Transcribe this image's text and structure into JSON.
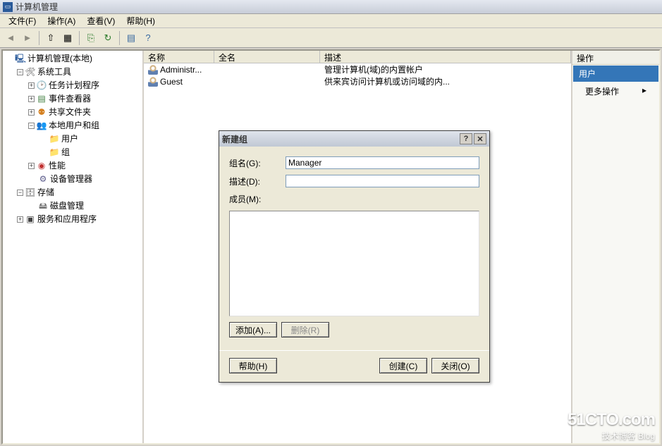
{
  "window": {
    "title": "计算机管理"
  },
  "menu": {
    "file": "文件(F)",
    "action": "操作(A)",
    "view": "查看(V)",
    "help": "帮助(H)"
  },
  "tree": {
    "root": "计算机管理(本地)",
    "system_tools": "系统工具",
    "task_scheduler": "任务计划程序",
    "event_viewer": "事件查看器",
    "shared_folders": "共享文件夹",
    "local_users_groups": "本地用户和组",
    "users": "用户",
    "groups": "组",
    "performance": "性能",
    "device_manager": "设备管理器",
    "storage": "存储",
    "disk_mgmt": "磁盘管理",
    "services_apps": "服务和应用程序"
  },
  "list": {
    "col_name": "名称",
    "col_fullname": "全名",
    "col_desc": "描述",
    "rows": [
      {
        "name": "Administr...",
        "fullname": "",
        "desc": "管理计算机(域)的内置帐户"
      },
      {
        "name": "Guest",
        "fullname": "",
        "desc": "供来宾访问计算机或访问域的内..."
      }
    ]
  },
  "actions": {
    "header": "操作",
    "category": "用户",
    "more": "更多操作"
  },
  "dialog": {
    "title": "新建组",
    "groupname_label": "组名(G):",
    "groupname_value": "Manager",
    "desc_label": "描述(D):",
    "desc_value": "",
    "members_label": "成员(M):",
    "add": "添加(A)...",
    "remove": "删除(R)",
    "help": "帮助(H)",
    "create": "创建(C)",
    "close": "关闭(O)"
  },
  "watermark": {
    "line1": "51CTO.com",
    "line2": "技术博客  Blog"
  }
}
